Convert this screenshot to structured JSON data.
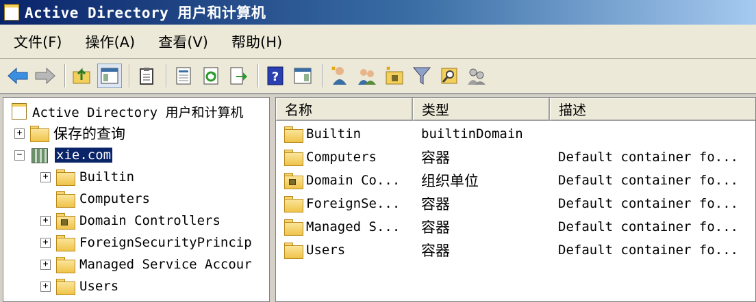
{
  "window": {
    "title": "Active Directory 用户和计算机"
  },
  "menu": [
    {
      "label": "文件(F)"
    },
    {
      "label": "操作(A)"
    },
    {
      "label": "查看(V)"
    },
    {
      "label": "帮助(H)"
    }
  ],
  "toolbar": {
    "buttons": [
      "back-arrow-icon",
      "forward-arrow-icon",
      "up-folder-icon",
      "show-hide-tree-icon",
      "clipboard-icon",
      "properties-icon",
      "refresh-icon",
      "export-list-icon",
      "help-icon",
      "action-pane-icon",
      "new-user-icon",
      "new-group-icon",
      "new-ou-icon",
      "filter-icon",
      "find-icon",
      "delegate-icon"
    ]
  },
  "tree": {
    "root": "Active Directory 用户和计算机",
    "saved_queries": "保存的查询",
    "domain": "xie.com",
    "children": [
      {
        "label": "Builtin",
        "expander": "+"
      },
      {
        "label": "Computers",
        "expander": ""
      },
      {
        "label": "Domain Controllers",
        "expander": "+"
      },
      {
        "label": "ForeignSecurityPrincip",
        "expander": "+"
      },
      {
        "label": "Managed Service Accour",
        "expander": "+"
      },
      {
        "label": "Users",
        "expander": "+"
      }
    ],
    "saved_expander": "+",
    "domain_expander": "−"
  },
  "list": {
    "columns": [
      "名称",
      "类型",
      "描述"
    ],
    "rows": [
      {
        "name": "Builtin",
        "type": "builtinDomain",
        "desc": ""
      },
      {
        "name": "Computers",
        "type": "容器",
        "desc": "Default container fo..."
      },
      {
        "name": "Domain Co...",
        "type": "组织单位",
        "desc": "Default container fo..."
      },
      {
        "name": "ForeignSe...",
        "type": "容器",
        "desc": "Default container fo..."
      },
      {
        "name": "Managed S...",
        "type": "容器",
        "desc": "Default container fo..."
      },
      {
        "name": "Users",
        "type": "容器",
        "desc": "Default container fo..."
      }
    ]
  }
}
